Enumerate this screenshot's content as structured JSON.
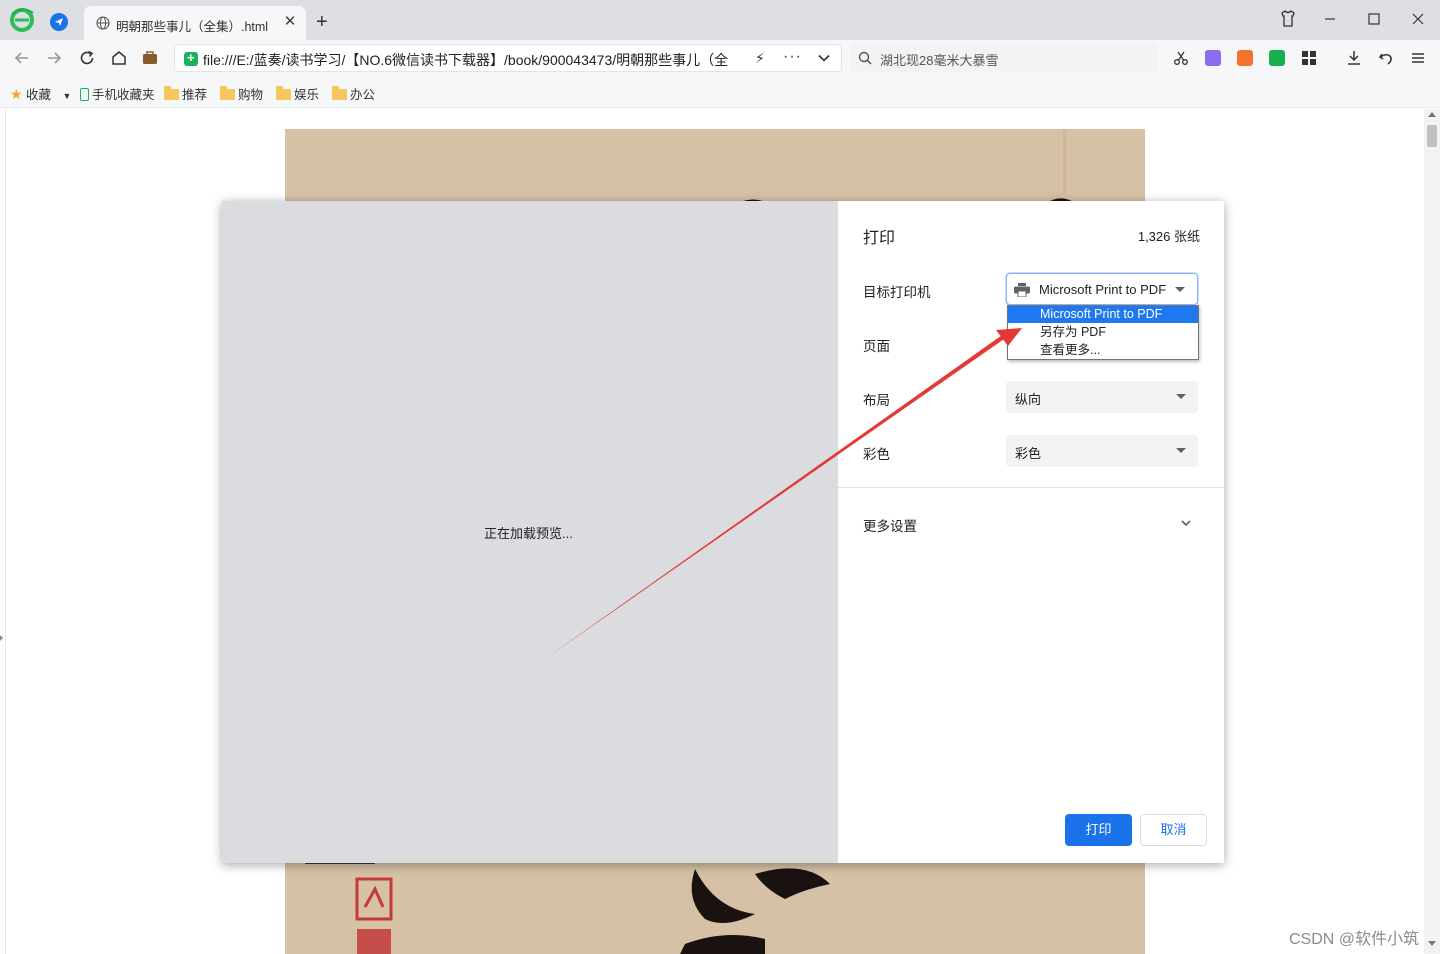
{
  "tabs": [
    {
      "title": "明朝那些事儿（全集）.html"
    }
  ],
  "address": {
    "url": "file:///E:/蓝奏/读书学习/【NO.6微信读书下载器】/book/900043473/明朝那些事儿（全"
  },
  "search": {
    "text": "湖北现28毫米大暴雪"
  },
  "bookmarks": {
    "favorites": "收藏",
    "mobile": "手机收藏夹",
    "folders": [
      "推荐",
      "购物",
      "娱乐",
      "办公"
    ]
  },
  "print_dialog": {
    "title": "打印",
    "sheets": "1,326 张纸",
    "preview_text": "正在加载预览...",
    "destination_label": "目标打印机",
    "destination_value": "Microsoft Print to PDF",
    "destination_options": [
      "Microsoft Print to PDF",
      "另存为 PDF",
      "查看更多..."
    ],
    "pages_label": "页面",
    "layout_label": "布局",
    "layout_value": "纵向",
    "color_label": "彩色",
    "color_value": "彩色",
    "more_settings": "更多设置",
    "print_button": "打印",
    "cancel_button": "取消"
  },
  "watermark": "CSDN @软件小筑",
  "colors": {
    "accent": "#1a73e8",
    "annotation_arrow": "#e53935"
  }
}
